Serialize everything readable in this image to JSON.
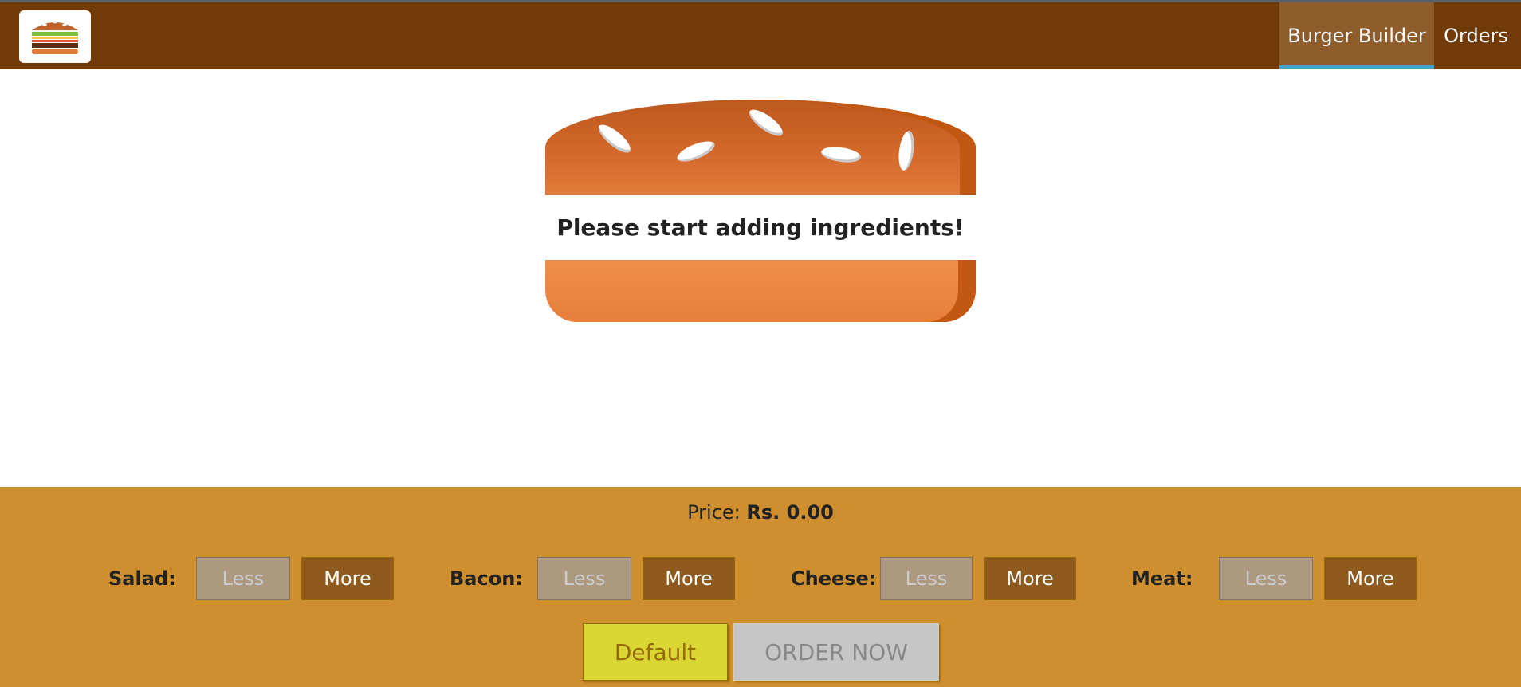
{
  "app": {
    "title": "Burger Builder"
  },
  "toolbar": {
    "logo_icon": "burger-logo-icon",
    "nav": [
      {
        "label": "Burger Builder",
        "active": true
      },
      {
        "label": "Orders",
        "active": false
      }
    ]
  },
  "burger": {
    "message": "Please start adding ingredients!"
  },
  "controls": {
    "price_label": "Price:",
    "price_value": "Rs. 0.00",
    "ingredients": [
      {
        "label": "Salad:",
        "less": "Less",
        "more": "More",
        "less_disabled": true
      },
      {
        "label": "Bacon:",
        "less": "Less",
        "more": "More",
        "less_disabled": true
      },
      {
        "label": "Cheese:",
        "less": "Less",
        "more": "More",
        "less_disabled": true
      },
      {
        "label": "Meat:",
        "less": "Less",
        "more": "More",
        "less_disabled": true
      }
    ],
    "default_label": "Default",
    "order_label": "ORDER NOW",
    "order_disabled": true
  },
  "colors": {
    "toolbar": "#703b09",
    "nav_active": "#8f5c2c",
    "nav_active_underline": "#40a4c8",
    "controls_bg": "#cf8f2e",
    "more_button": "#8f5a1e",
    "less_button_disabled": "#ac9980",
    "default_button": "#dad735",
    "order_button_disabled": "#c7c6c6"
  }
}
